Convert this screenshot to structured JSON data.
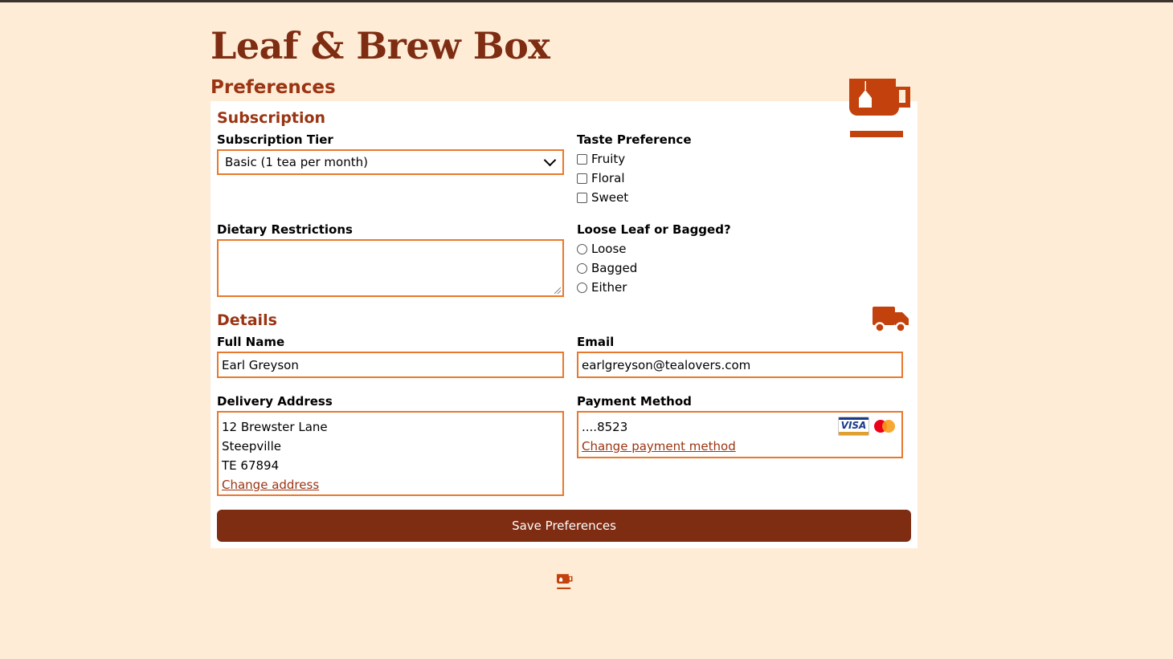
{
  "app": {
    "title": "Leaf & Brew Box",
    "page_heading": "Preferences"
  },
  "subscription": {
    "heading": "Subscription",
    "tier_label": "Subscription Tier",
    "tier_value": "Basic (1 tea per month)",
    "taste_label": "Taste Preference",
    "taste_options": [
      "Fruity",
      "Floral",
      "Sweet"
    ],
    "dietary_label": "Dietary Restrictions",
    "dietary_value": "",
    "leaf_label": "Loose Leaf or Bagged?",
    "leaf_options": [
      "Loose",
      "Bagged",
      "Either"
    ]
  },
  "details": {
    "heading": "Details",
    "name_label": "Full Name",
    "name_value": "Earl Greyson",
    "email_label": "Email",
    "email_value": "earlgreyson@tealovers.com",
    "address_label": "Delivery Address",
    "address_lines": [
      "12 Brewster Lane",
      "Steepville",
      "TE 67894"
    ],
    "change_address": "Change address",
    "payment_label": "Payment Method",
    "card_masked": "....8523",
    "change_payment": "Change payment method",
    "card_brands": [
      "VISA",
      "Mastercard"
    ]
  },
  "actions": {
    "save_label": "Save Preferences"
  },
  "icons": {
    "header": "mug-icon",
    "details": "truck-icon",
    "footer": "mug-icon"
  },
  "colors": {
    "background": "#feecd6",
    "brand": "#7e2c12",
    "accent": "#9a3412",
    "input_border": "#e8792c"
  }
}
